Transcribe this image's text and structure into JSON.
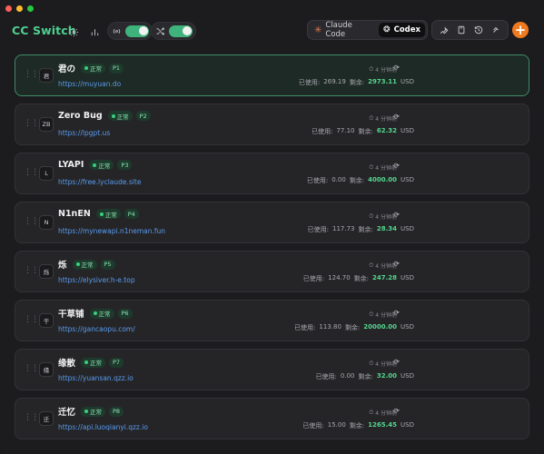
{
  "app": {
    "title": "CC Switch"
  },
  "toolbar": {
    "tabs": [
      {
        "label": "Claude Code",
        "icon": "claude-icon",
        "active": false
      },
      {
        "label": "Codex",
        "icon": "codex-icon",
        "active": true
      }
    ],
    "add_label": "+"
  },
  "providers": [
    {
      "avatar": "君",
      "name": "君の",
      "status": "正常",
      "priority": "P1",
      "url": "https://muyuan.do",
      "updated": "4 分钟前",
      "used_label": "已使用:",
      "used": "269.19",
      "remain_label": "剩余:",
      "remain": "2973.11",
      "unit": "USD",
      "active": true
    },
    {
      "avatar": "ZB",
      "name": "Zero Bug",
      "status": "正常",
      "priority": "P2",
      "url": "https://lpgpt.us",
      "updated": "4 分钟前",
      "used_label": "已使用:",
      "used": "77.10",
      "remain_label": "剩余:",
      "remain": "62.32",
      "unit": "USD",
      "active": false
    },
    {
      "avatar": "L",
      "name": "LYAPI",
      "status": "正常",
      "priority": "P3",
      "url": "https://free.lyclaude.site",
      "updated": "4 分钟前",
      "used_label": "已使用:",
      "used": "0.00",
      "remain_label": "剩余:",
      "remain": "4000.00",
      "unit": "USD",
      "active": false
    },
    {
      "avatar": "N",
      "name": "N1nEN",
      "status": "正常",
      "priority": "P4",
      "url": "https://mynewapi.n1neman.fun",
      "updated": "4 分钟前",
      "used_label": "已使用:",
      "used": "117.73",
      "remain_label": "剩余:",
      "remain": "28.34",
      "unit": "USD",
      "active": false
    },
    {
      "avatar": "烁",
      "name": "烁",
      "status": "正常",
      "priority": "P5",
      "url": "https://elysiver.h-e.top",
      "updated": "4 分钟前",
      "used_label": "已使用:",
      "used": "124.70",
      "remain_label": "剩余:",
      "remain": "247.28",
      "unit": "USD",
      "active": false
    },
    {
      "avatar": "干",
      "name": "干草铺",
      "status": "正常",
      "priority": "P6",
      "url": "https://gancaopu.com/",
      "updated": "4 分钟前",
      "used_label": "已使用:",
      "used": "113.80",
      "remain_label": "剩余:",
      "remain": "20000.00",
      "unit": "USD",
      "active": false
    },
    {
      "avatar": "缘",
      "name": "缘散",
      "status": "正常",
      "priority": "P7",
      "url": "https://yuansan.qzz.io",
      "updated": "4 分钟前",
      "used_label": "已使用:",
      "used": "0.00",
      "remain_label": "剩余:",
      "remain": "32.00",
      "unit": "USD",
      "active": false
    },
    {
      "avatar": "迁",
      "name": "迁忆",
      "status": "正常",
      "priority": "P8",
      "url": "https://api.luoqianyi.qzz.io",
      "updated": "4 分钟前",
      "used_label": "已使用:",
      "used": "15.00",
      "remain_label": "剩余:",
      "remain": "1265.45",
      "unit": "USD",
      "active": false
    }
  ]
}
